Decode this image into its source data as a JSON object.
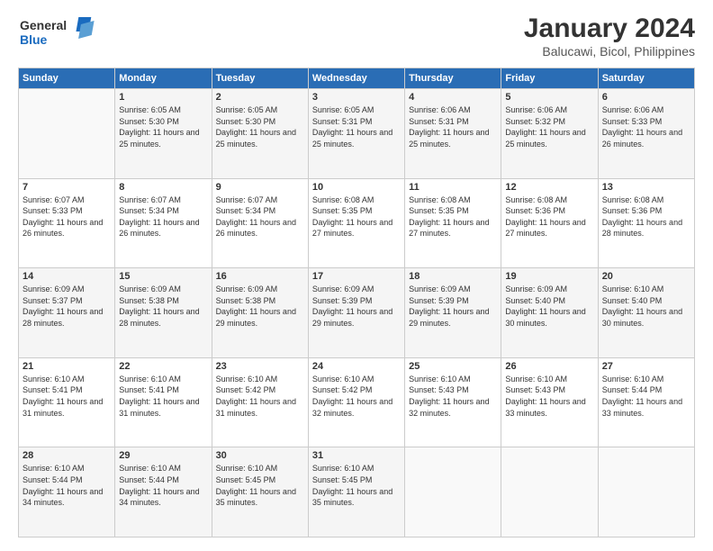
{
  "logo": {
    "line1": "General",
    "line2": "Blue"
  },
  "title": "January 2024",
  "subtitle": "Balucawi, Bicol, Philippines",
  "header_days": [
    "Sunday",
    "Monday",
    "Tuesday",
    "Wednesday",
    "Thursday",
    "Friday",
    "Saturday"
  ],
  "weeks": [
    [
      {
        "day": "",
        "sunrise": "",
        "sunset": "",
        "daylight": ""
      },
      {
        "day": "1",
        "sunrise": "Sunrise: 6:05 AM",
        "sunset": "Sunset: 5:30 PM",
        "daylight": "Daylight: 11 hours and 25 minutes."
      },
      {
        "day": "2",
        "sunrise": "Sunrise: 6:05 AM",
        "sunset": "Sunset: 5:30 PM",
        "daylight": "Daylight: 11 hours and 25 minutes."
      },
      {
        "day": "3",
        "sunrise": "Sunrise: 6:05 AM",
        "sunset": "Sunset: 5:31 PM",
        "daylight": "Daylight: 11 hours and 25 minutes."
      },
      {
        "day": "4",
        "sunrise": "Sunrise: 6:06 AM",
        "sunset": "Sunset: 5:31 PM",
        "daylight": "Daylight: 11 hours and 25 minutes."
      },
      {
        "day": "5",
        "sunrise": "Sunrise: 6:06 AM",
        "sunset": "Sunset: 5:32 PM",
        "daylight": "Daylight: 11 hours and 25 minutes."
      },
      {
        "day": "6",
        "sunrise": "Sunrise: 6:06 AM",
        "sunset": "Sunset: 5:33 PM",
        "daylight": "Daylight: 11 hours and 26 minutes."
      }
    ],
    [
      {
        "day": "7",
        "sunrise": "Sunrise: 6:07 AM",
        "sunset": "Sunset: 5:33 PM",
        "daylight": "Daylight: 11 hours and 26 minutes."
      },
      {
        "day": "8",
        "sunrise": "Sunrise: 6:07 AM",
        "sunset": "Sunset: 5:34 PM",
        "daylight": "Daylight: 11 hours and 26 minutes."
      },
      {
        "day": "9",
        "sunrise": "Sunrise: 6:07 AM",
        "sunset": "Sunset: 5:34 PM",
        "daylight": "Daylight: 11 hours and 26 minutes."
      },
      {
        "day": "10",
        "sunrise": "Sunrise: 6:08 AM",
        "sunset": "Sunset: 5:35 PM",
        "daylight": "Daylight: 11 hours and 27 minutes."
      },
      {
        "day": "11",
        "sunrise": "Sunrise: 6:08 AM",
        "sunset": "Sunset: 5:35 PM",
        "daylight": "Daylight: 11 hours and 27 minutes."
      },
      {
        "day": "12",
        "sunrise": "Sunrise: 6:08 AM",
        "sunset": "Sunset: 5:36 PM",
        "daylight": "Daylight: 11 hours and 27 minutes."
      },
      {
        "day": "13",
        "sunrise": "Sunrise: 6:08 AM",
        "sunset": "Sunset: 5:36 PM",
        "daylight": "Daylight: 11 hours and 28 minutes."
      }
    ],
    [
      {
        "day": "14",
        "sunrise": "Sunrise: 6:09 AM",
        "sunset": "Sunset: 5:37 PM",
        "daylight": "Daylight: 11 hours and 28 minutes."
      },
      {
        "day": "15",
        "sunrise": "Sunrise: 6:09 AM",
        "sunset": "Sunset: 5:38 PM",
        "daylight": "Daylight: 11 hours and 28 minutes."
      },
      {
        "day": "16",
        "sunrise": "Sunrise: 6:09 AM",
        "sunset": "Sunset: 5:38 PM",
        "daylight": "Daylight: 11 hours and 29 minutes."
      },
      {
        "day": "17",
        "sunrise": "Sunrise: 6:09 AM",
        "sunset": "Sunset: 5:39 PM",
        "daylight": "Daylight: 11 hours and 29 minutes."
      },
      {
        "day": "18",
        "sunrise": "Sunrise: 6:09 AM",
        "sunset": "Sunset: 5:39 PM",
        "daylight": "Daylight: 11 hours and 29 minutes."
      },
      {
        "day": "19",
        "sunrise": "Sunrise: 6:09 AM",
        "sunset": "Sunset: 5:40 PM",
        "daylight": "Daylight: 11 hours and 30 minutes."
      },
      {
        "day": "20",
        "sunrise": "Sunrise: 6:10 AM",
        "sunset": "Sunset: 5:40 PM",
        "daylight": "Daylight: 11 hours and 30 minutes."
      }
    ],
    [
      {
        "day": "21",
        "sunrise": "Sunrise: 6:10 AM",
        "sunset": "Sunset: 5:41 PM",
        "daylight": "Daylight: 11 hours and 31 minutes."
      },
      {
        "day": "22",
        "sunrise": "Sunrise: 6:10 AM",
        "sunset": "Sunset: 5:41 PM",
        "daylight": "Daylight: 11 hours and 31 minutes."
      },
      {
        "day": "23",
        "sunrise": "Sunrise: 6:10 AM",
        "sunset": "Sunset: 5:42 PM",
        "daylight": "Daylight: 11 hours and 31 minutes."
      },
      {
        "day": "24",
        "sunrise": "Sunrise: 6:10 AM",
        "sunset": "Sunset: 5:42 PM",
        "daylight": "Daylight: 11 hours and 32 minutes."
      },
      {
        "day": "25",
        "sunrise": "Sunrise: 6:10 AM",
        "sunset": "Sunset: 5:43 PM",
        "daylight": "Daylight: 11 hours and 32 minutes."
      },
      {
        "day": "26",
        "sunrise": "Sunrise: 6:10 AM",
        "sunset": "Sunset: 5:43 PM",
        "daylight": "Daylight: 11 hours and 33 minutes."
      },
      {
        "day": "27",
        "sunrise": "Sunrise: 6:10 AM",
        "sunset": "Sunset: 5:44 PM",
        "daylight": "Daylight: 11 hours and 33 minutes."
      }
    ],
    [
      {
        "day": "28",
        "sunrise": "Sunrise: 6:10 AM",
        "sunset": "Sunset: 5:44 PM",
        "daylight": "Daylight: 11 hours and 34 minutes."
      },
      {
        "day": "29",
        "sunrise": "Sunrise: 6:10 AM",
        "sunset": "Sunset: 5:44 PM",
        "daylight": "Daylight: 11 hours and 34 minutes."
      },
      {
        "day": "30",
        "sunrise": "Sunrise: 6:10 AM",
        "sunset": "Sunset: 5:45 PM",
        "daylight": "Daylight: 11 hours and 35 minutes."
      },
      {
        "day": "31",
        "sunrise": "Sunrise: 6:10 AM",
        "sunset": "Sunset: 5:45 PM",
        "daylight": "Daylight: 11 hours and 35 minutes."
      },
      {
        "day": "",
        "sunrise": "",
        "sunset": "",
        "daylight": ""
      },
      {
        "day": "",
        "sunrise": "",
        "sunset": "",
        "daylight": ""
      },
      {
        "day": "",
        "sunrise": "",
        "sunset": "",
        "daylight": ""
      }
    ]
  ]
}
